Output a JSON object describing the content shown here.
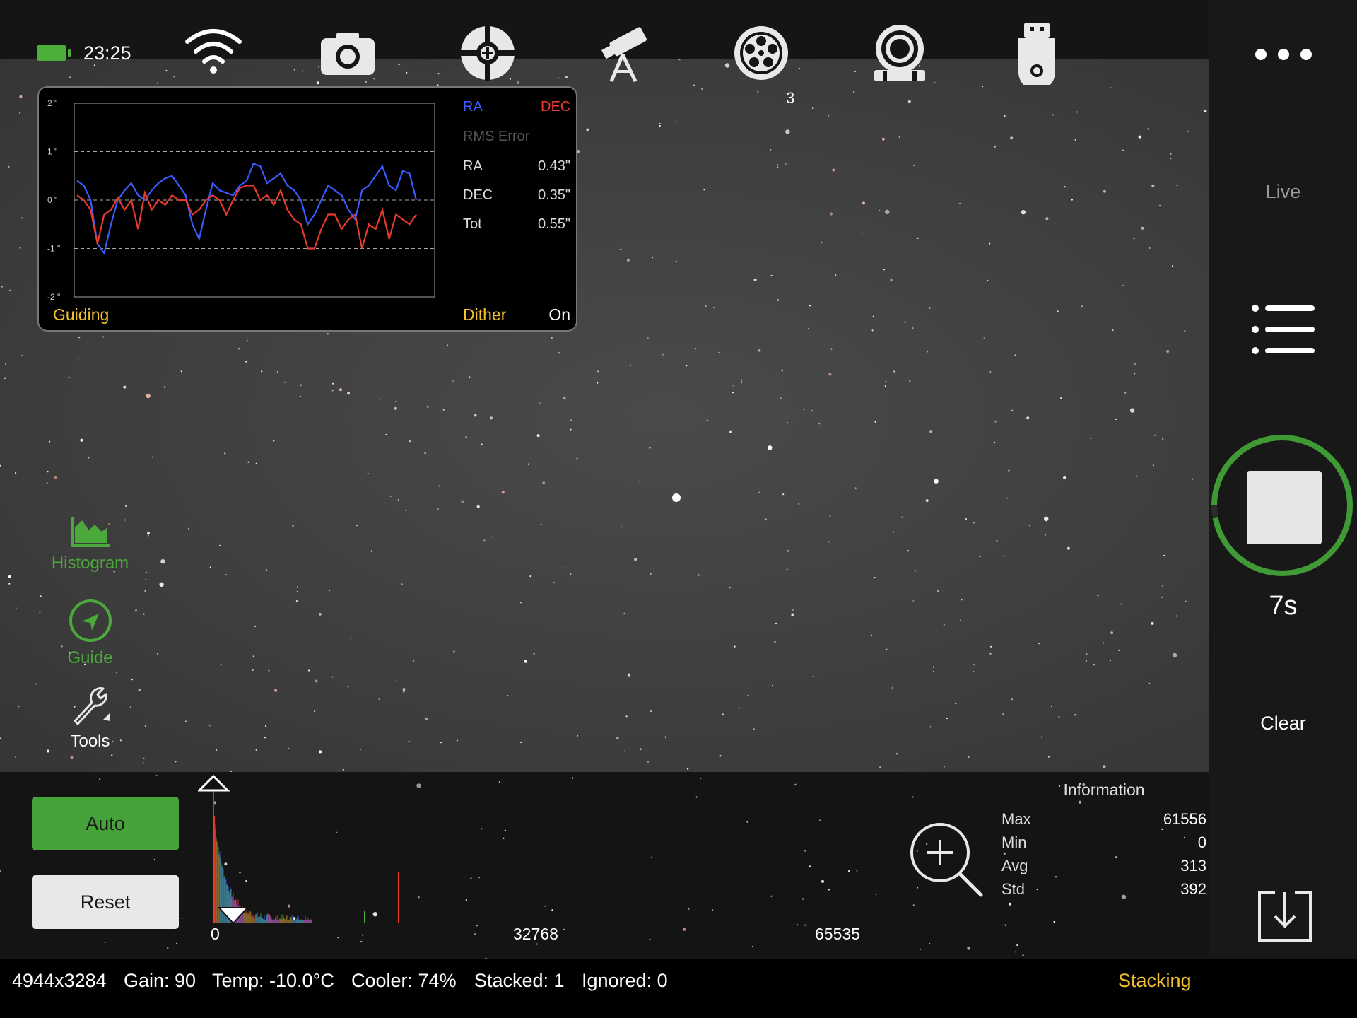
{
  "status_bar_top": {
    "clock": "23:25"
  },
  "toolbar": {
    "icons": [
      "wifi-icon",
      "camera-icon",
      "focus-target-icon",
      "telescope-icon",
      "filter-wheel-icon",
      "guide-camera-icon",
      "usb-storage-icon"
    ],
    "filter_wheel_position": "3",
    "more_icon": "more-icon"
  },
  "guiding": {
    "legend_ra": "RA",
    "legend_dec": "DEC",
    "rms_title": "RMS Error",
    "rows": [
      {
        "label": "RA",
        "value": "0.43\""
      },
      {
        "label": "DEC",
        "value": "0.35\""
      },
      {
        "label": "Tot",
        "value": "0.55\""
      }
    ],
    "footer_left": "Guiding",
    "footer_dither": "Dither",
    "footer_dither_state": "On",
    "y_ticks": [
      "2 \"",
      "1 \"",
      "0 \"",
      "-1 \"",
      "-2 \""
    ],
    "colors": {
      "ra": "#3b5bff",
      "dec": "#e83a2e"
    },
    "chart_data": {
      "type": "line",
      "ylim": [
        -2,
        2
      ],
      "series": [
        {
          "name": "RA",
          "values": [
            0.4,
            0.3,
            0.0,
            -0.9,
            -1.1,
            -0.5,
            0.0,
            0.2,
            0.35,
            0.1,
            0.0,
            0.2,
            0.35,
            0.45,
            0.5,
            0.3,
            0.1,
            -0.5,
            -0.8,
            -0.2,
            0.35,
            0.2,
            0.15,
            0.1,
            0.3,
            0.4,
            0.75,
            0.7,
            0.35,
            0.45,
            0.55,
            0.3,
            0.2,
            0.0,
            -0.5,
            -0.3,
            0.0,
            0.3,
            0.2,
            0.1,
            -0.2,
            -0.4,
            0.2,
            0.3,
            0.5,
            0.7,
            0.3,
            0.2,
            0.6,
            0.55,
            0.0
          ]
        },
        {
          "name": "DEC",
          "values": [
            0.1,
            0.0,
            -0.2,
            -0.9,
            -0.3,
            -0.2,
            0.05,
            -0.2,
            0.0,
            -0.6,
            0.15,
            -0.2,
            0.0,
            -0.1,
            0.1,
            0.0,
            0.0,
            -0.3,
            -0.2,
            0.0,
            0.1,
            0.0,
            -0.3,
            0.0,
            0.25,
            0.3,
            0.3,
            0.0,
            0.1,
            -0.1,
            0.2,
            -0.2,
            -0.4,
            -0.5,
            -1.0,
            -1.0,
            -0.6,
            -0.3,
            -0.3,
            -0.6,
            -0.4,
            -0.3,
            -1.0,
            -0.5,
            -0.6,
            -0.2,
            -0.8,
            -0.3,
            -0.4,
            -0.5,
            -0.3
          ]
        }
      ]
    }
  },
  "tools": {
    "histogram_label": "Histogram",
    "guide_label": "Guide",
    "tools_label": "Tools"
  },
  "right_panel": {
    "mode_label": "Live",
    "exposure_remaining": "7s",
    "clear_label": "Clear",
    "progress": 0.97
  },
  "histogram": {
    "auto_label": "Auto",
    "reset_label": "Reset",
    "ticks": [
      "0",
      "32768",
      "65535"
    ]
  },
  "information": {
    "title": "Information",
    "rows": [
      {
        "label": "Max",
        "value": "61556"
      },
      {
        "label": "Min",
        "value": "0"
      },
      {
        "label": "Avg",
        "value": "313"
      },
      {
        "label": "Std",
        "value": "392"
      }
    ]
  },
  "status": {
    "resolution": "4944x3284",
    "gain": "Gain: 90",
    "temp": "Temp: -10.0°C",
    "cooler": "Cooler: 74%",
    "stacked": "Stacked: 1",
    "ignored": "Ignored: 0",
    "mode": "Stacking"
  }
}
